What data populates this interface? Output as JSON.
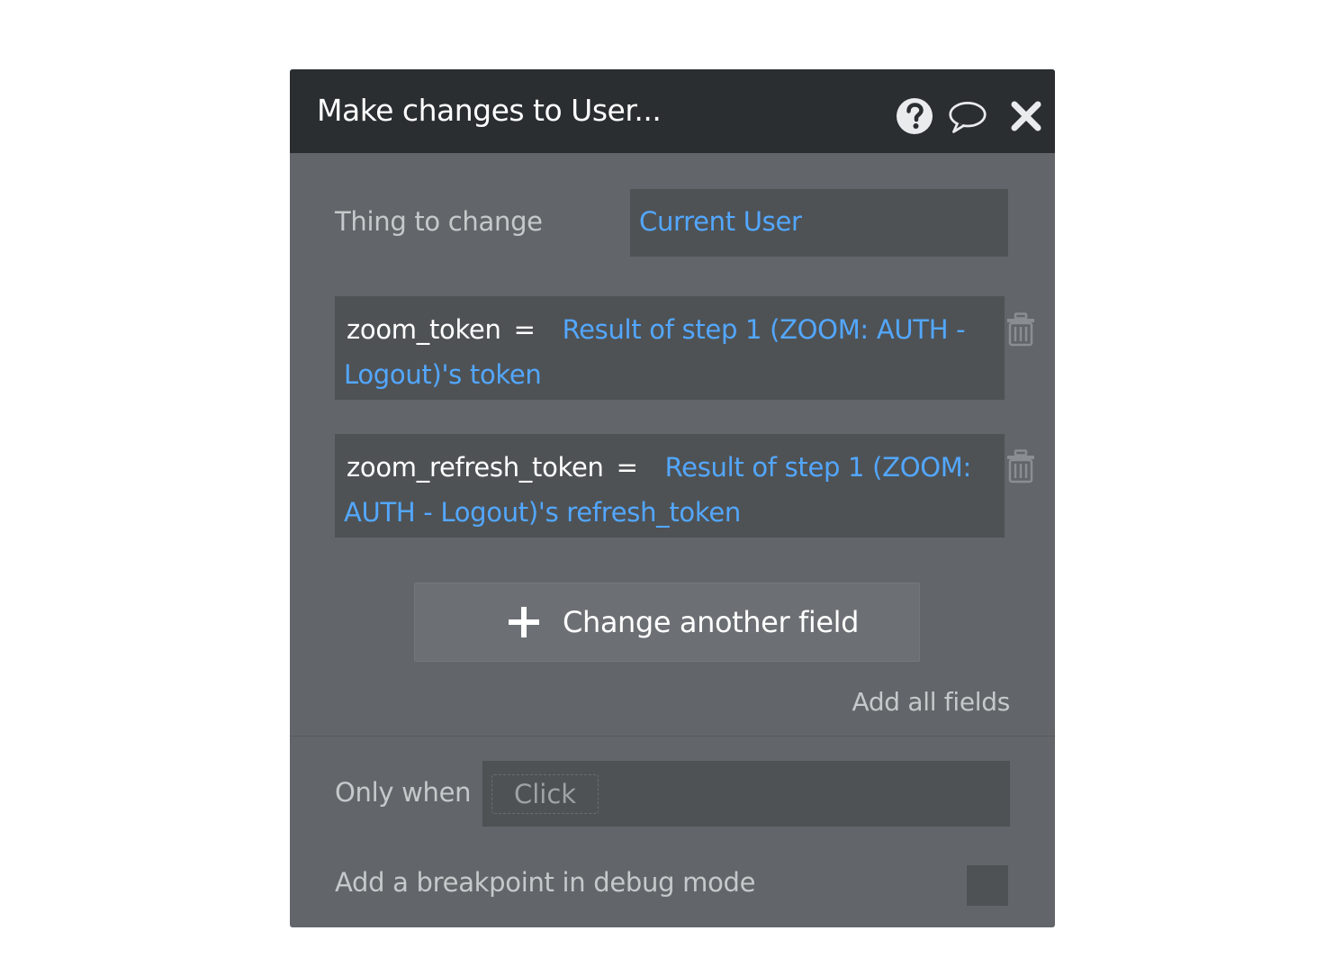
{
  "dialog": {
    "title": "Make changes to User..."
  },
  "icons": {
    "help": "help-circle-icon",
    "comment": "comment-bubble-icon",
    "close": "close-x-icon",
    "trash": "trash-icon",
    "plus": "plus-icon"
  },
  "thing": {
    "label": "Thing to change",
    "value": "Current User"
  },
  "fields": [
    {
      "name": "zoom_token",
      "operator": "=",
      "expression": "Result of step 1 (ZOOM: AUTH - Logout)'s token"
    },
    {
      "name": "zoom_refresh_token",
      "operator": "=",
      "expression": "Result of step 1 (ZOOM: AUTH - Logout)'s refresh_token"
    }
  ],
  "actions": {
    "change_another_field": "Change another field",
    "add_all_fields": "Add all fields"
  },
  "condition": {
    "label": "Only when",
    "placeholder": "Click"
  },
  "breakpoint": {
    "label": "Add a breakpoint in debug mode",
    "checked": false
  },
  "colors": {
    "header_bg": "#2a2e31",
    "panel_bg": "#62666a",
    "field_bg": "#4e5255",
    "accent": "#53a7ff"
  }
}
